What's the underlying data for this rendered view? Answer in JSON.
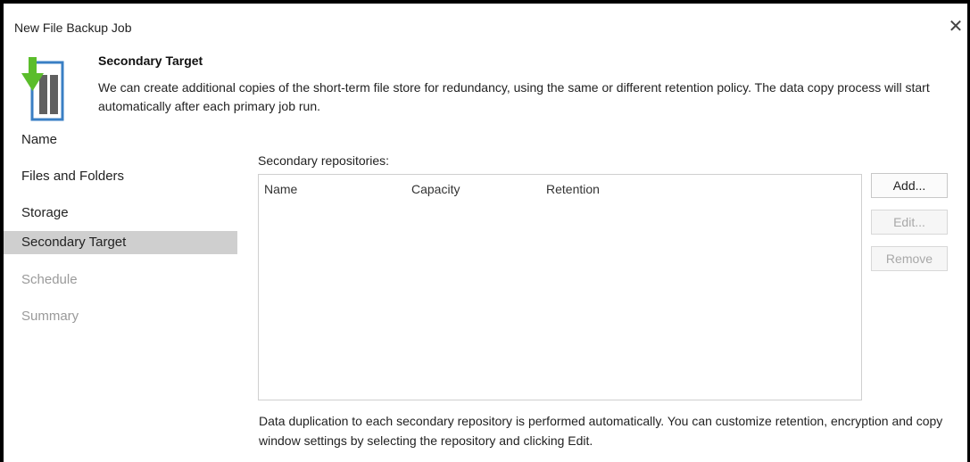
{
  "window": {
    "title": "New File Backup Job",
    "close_glyph": "✕"
  },
  "header": {
    "title": "Secondary Target",
    "description": "We can create additional copies of the short-term file store for redundancy, using the same or different retention policy. The data copy process will start automatically after each primary job run.",
    "icon": "backup-job-icon",
    "colors": {
      "arrow": "#5bbd2b",
      "frame": "#3a7fc4",
      "bars": "#606060"
    }
  },
  "nav": {
    "items": [
      {
        "label": "Name",
        "state": "done"
      },
      {
        "label": "Files and Folders",
        "state": "done"
      },
      {
        "label": "Storage",
        "state": "done"
      },
      {
        "label": "Secondary Target",
        "state": "active"
      },
      {
        "label": "Schedule",
        "state": "disabled"
      },
      {
        "label": "Summary",
        "state": "disabled"
      }
    ]
  },
  "main": {
    "repositories_label": "Secondary repositories:",
    "columns": [
      "Name",
      "Capacity",
      "Retention"
    ],
    "rows": [],
    "buttons": {
      "add": "Add...",
      "edit": "Edit...",
      "remove": "Remove"
    },
    "note": "Data duplication to each secondary repository is performed automatically. You can customize retention, encryption and copy window settings by selecting the repository and clicking Edit."
  }
}
